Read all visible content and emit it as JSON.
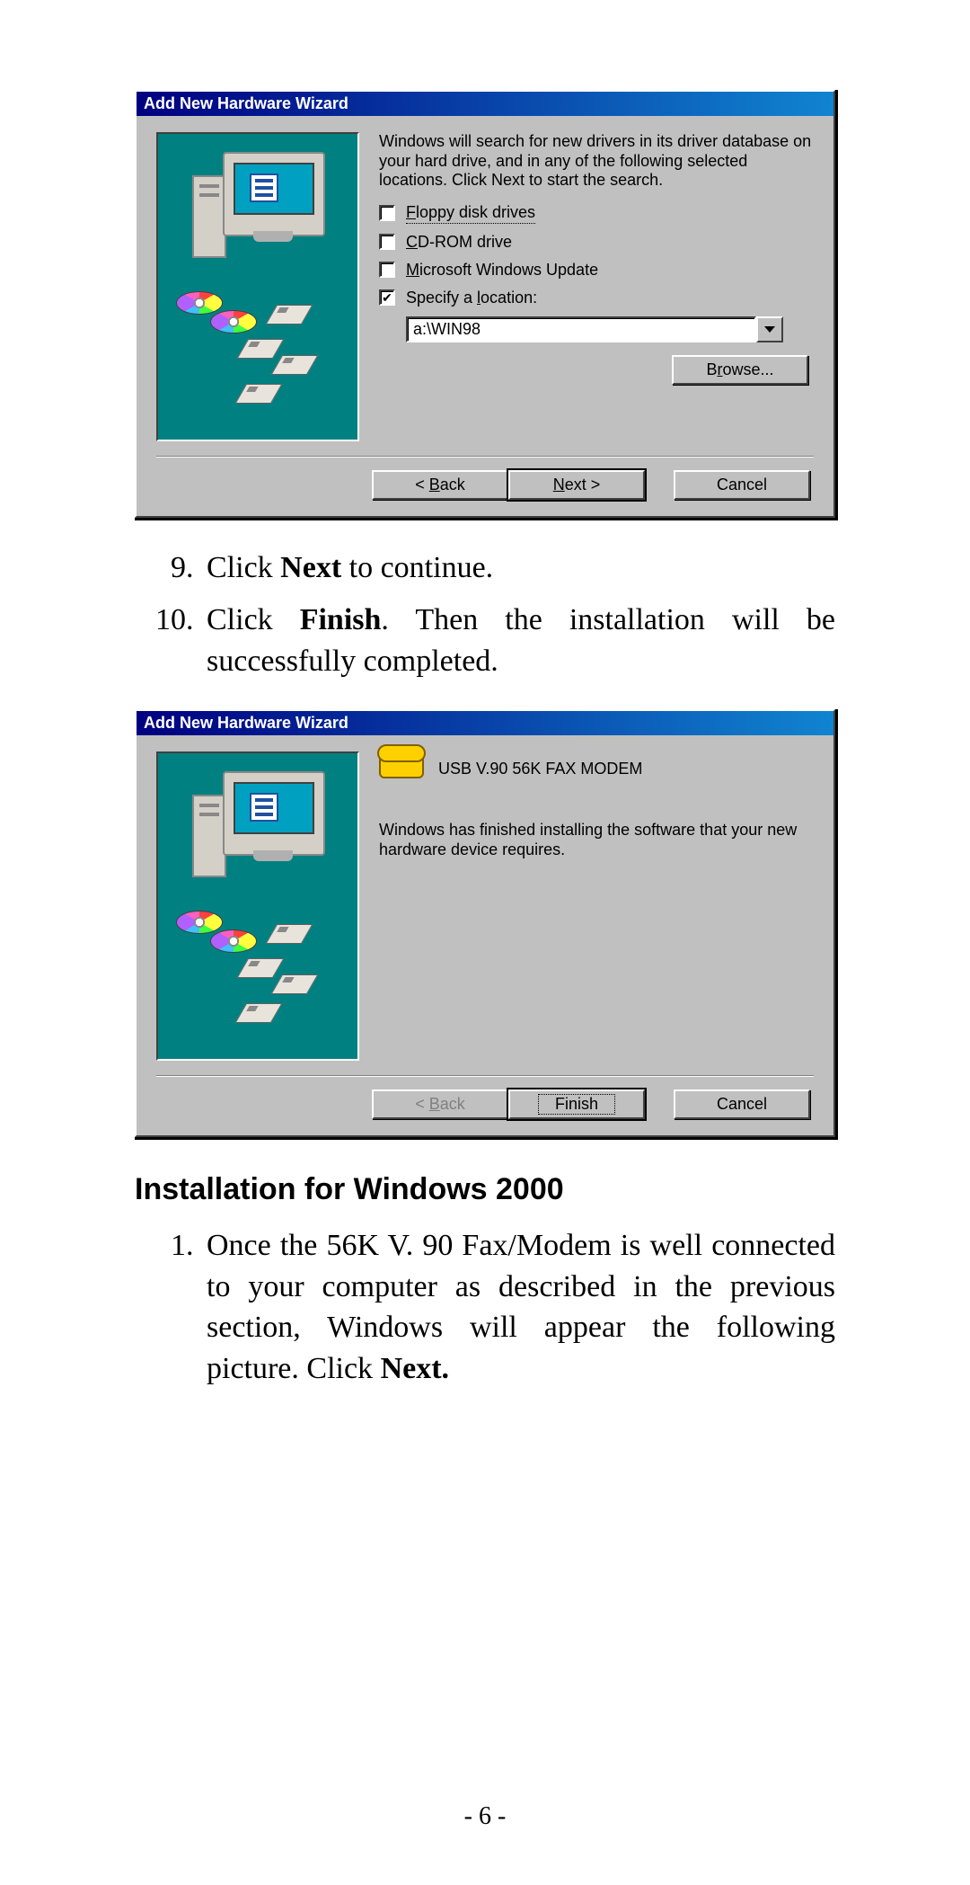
{
  "dialog1": {
    "title": "Add New Hardware Wizard",
    "intro": "Windows will search for new drivers in its driver database on your hard drive, and in any of the following selected locations. Click Next to start the search.",
    "opt_floppy": "Floppy disk drives",
    "opt_cdrom": "CD-ROM drive",
    "opt_update": "Microsoft Windows Update",
    "opt_specify": "Specify a location:",
    "path_value": "a:\\WIN98",
    "browse": "Browse...",
    "back": "< Back",
    "next": "Next >",
    "cancel": "Cancel"
  },
  "steps_a": {
    "s9_before": "Click ",
    "s9_bold": "Next",
    "s9_after": " to continue.",
    "s10_before": "Click ",
    "s10_bold": "Finish",
    "s10_after": ".  Then the installation will be successfully completed."
  },
  "dialog2": {
    "title": "Add New Hardware Wizard",
    "device": "USB V.90 56K FAX MODEM",
    "done": "Windows has finished installing the software that your new hardware device requires.",
    "back": "< Back",
    "finish": "Finish",
    "cancel": "Cancel"
  },
  "section_heading": "Installation for Windows 2000",
  "steps_b": {
    "s1_before": "Once the 56K V. 90 Fax/Modem is well connected to your computer as described in the previous section, Windows will appear the following picture.  Click ",
    "s1_bold": "Next."
  },
  "page_number": "- 6 -"
}
